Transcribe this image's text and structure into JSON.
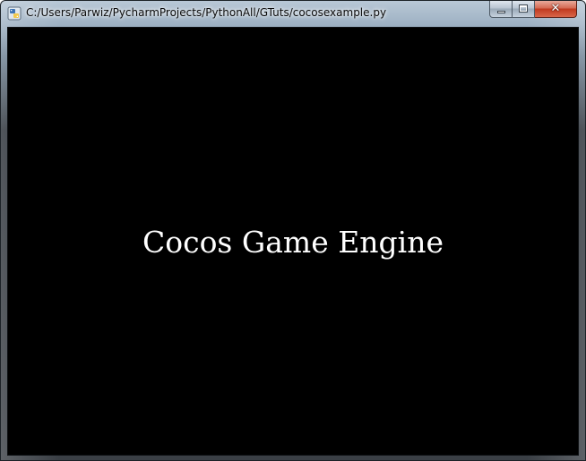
{
  "window": {
    "title": "C:/Users/Parwiz/PycharmProjects/PythonAll/GTuts/cocosexample.py",
    "icon": "python-icon",
    "controls": {
      "minimize": "minimize-icon",
      "maximize": "maximize-icon",
      "close_glyph": "✕"
    }
  },
  "scene": {
    "background": "#000000",
    "label": "Cocos Game Engine",
    "label_color": "#ffffff"
  }
}
